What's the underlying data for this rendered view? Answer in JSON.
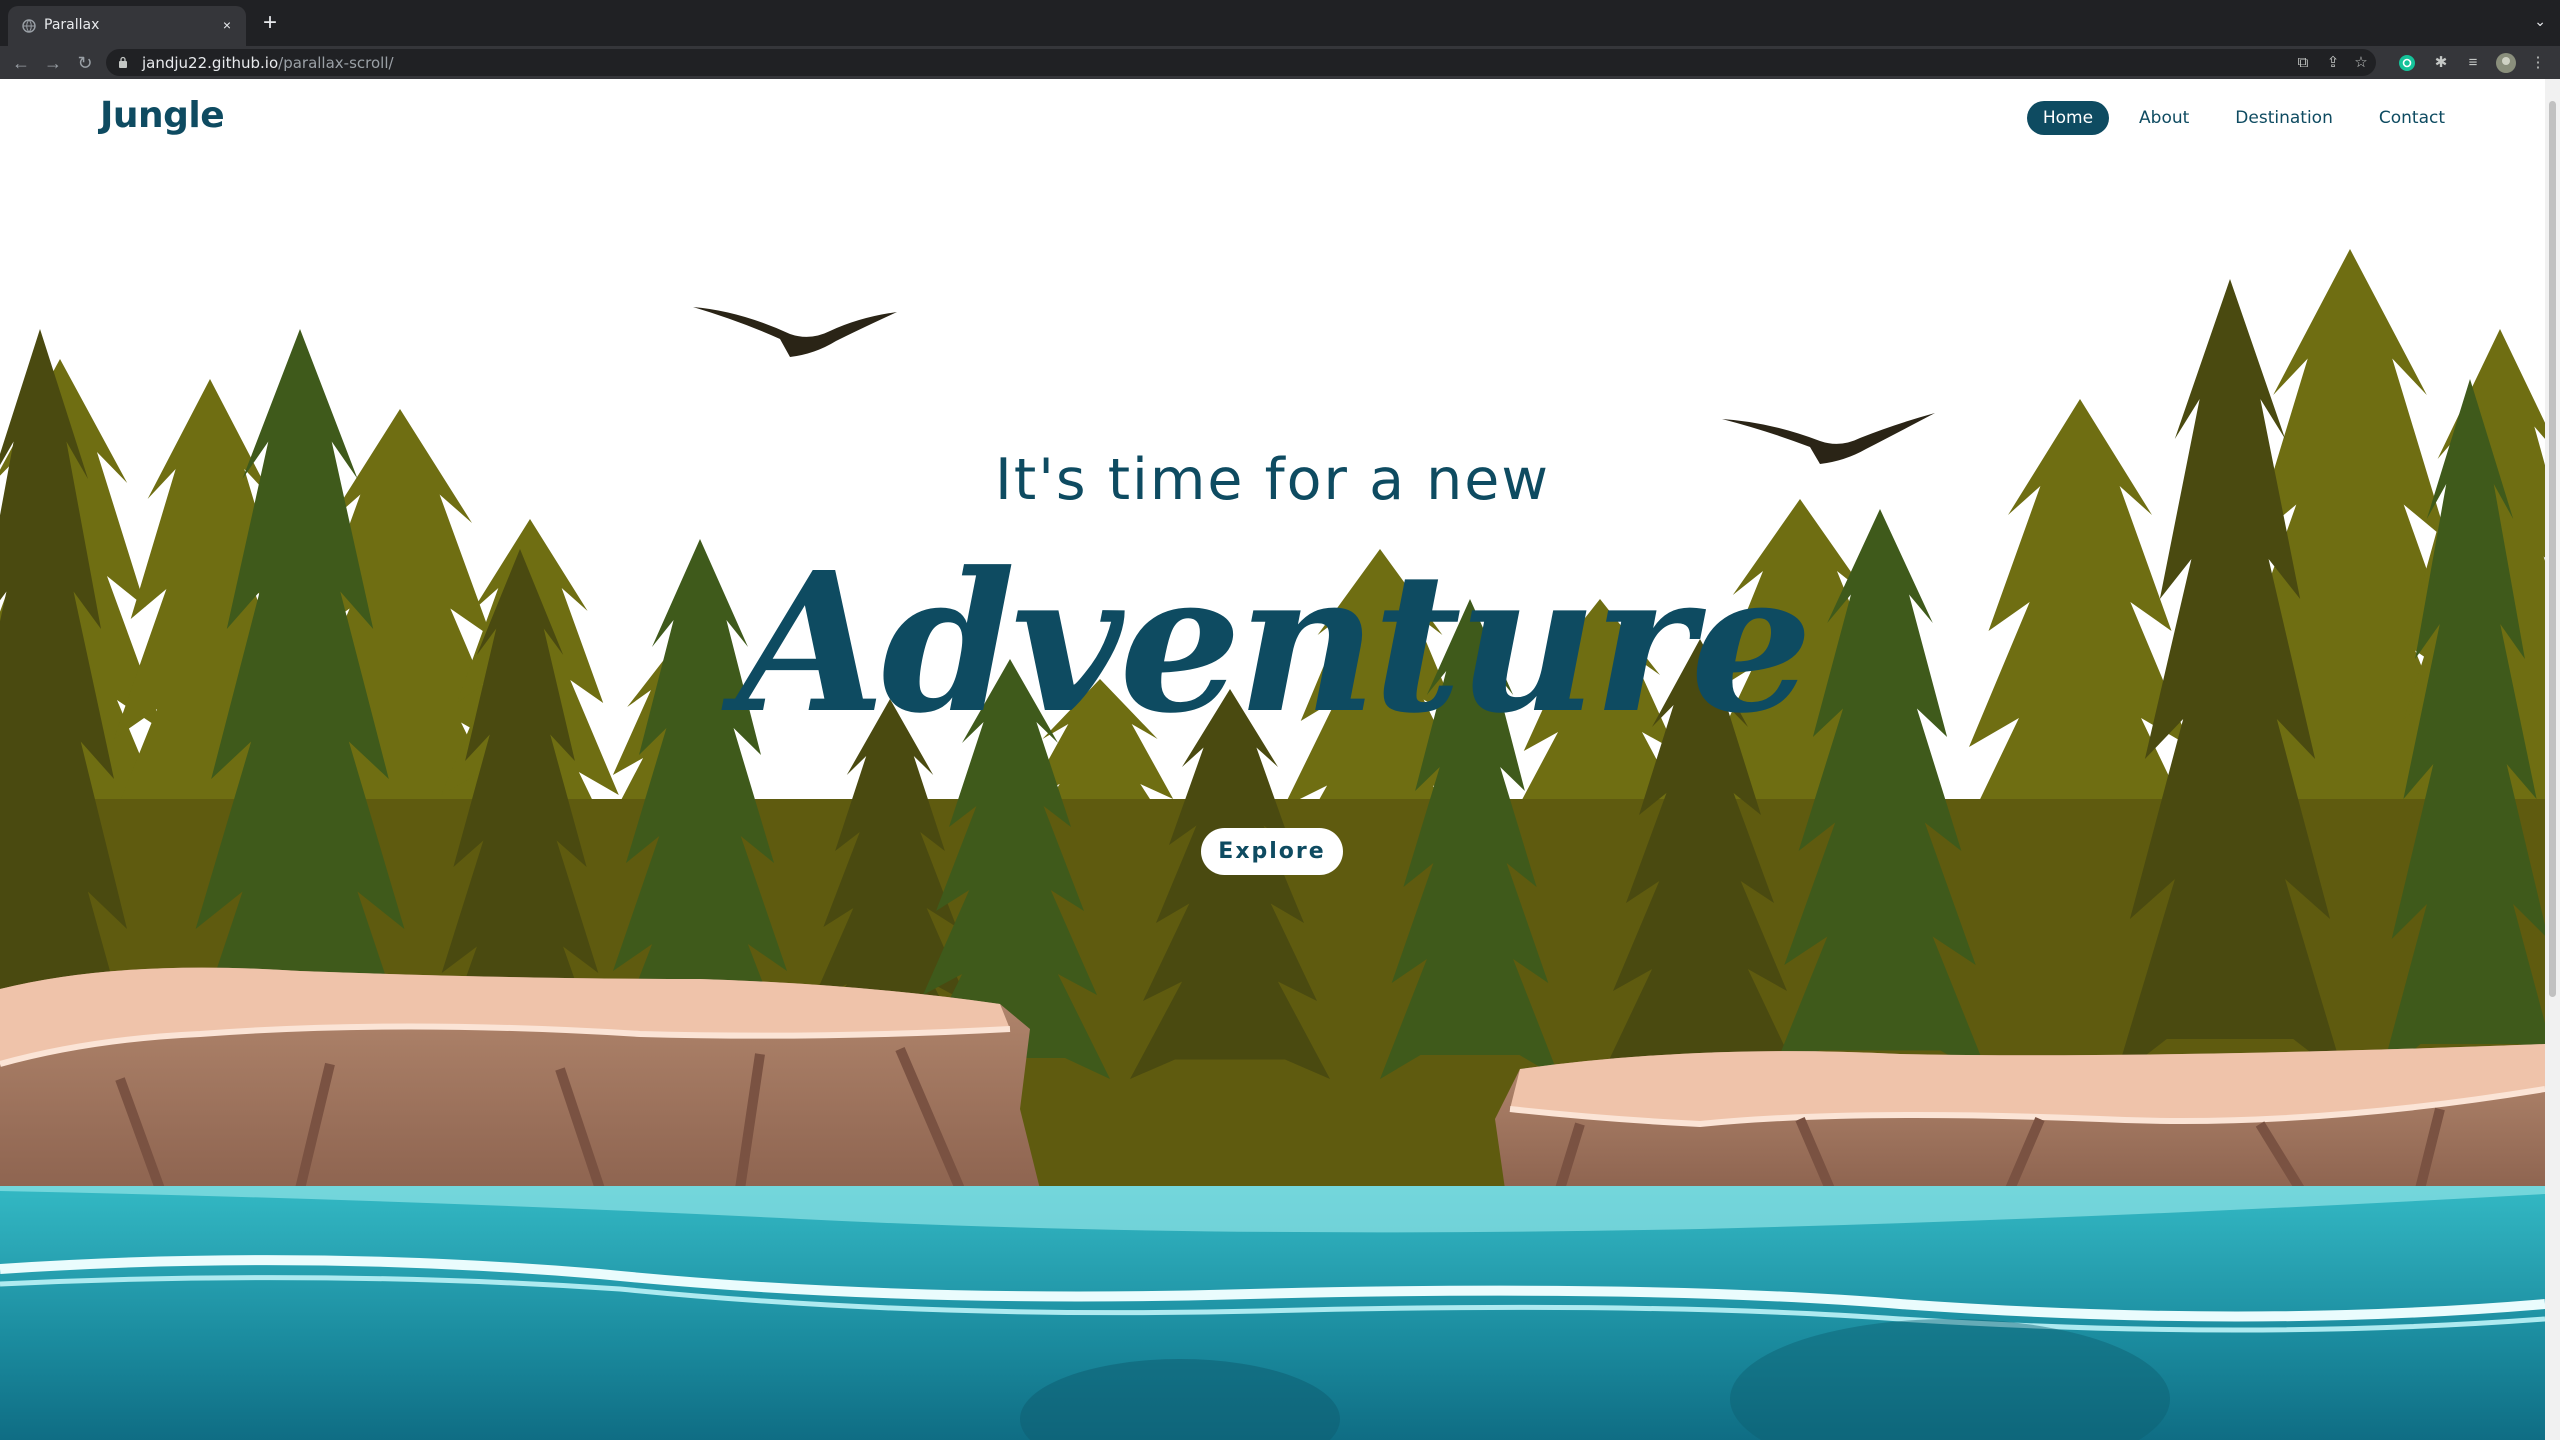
{
  "browser": {
    "tab": {
      "title": "Parallax",
      "close_icon": "×"
    },
    "new_tab_icon": "+",
    "url": {
      "host": "jandju22.github.io",
      "path": "/parallax-scroll/"
    }
  },
  "site": {
    "logo": "Jungle",
    "nav": [
      {
        "label": "Home",
        "active": true
      },
      {
        "label": "About",
        "active": false
      },
      {
        "label": "Destination",
        "active": false
      },
      {
        "label": "Contact",
        "active": false
      }
    ],
    "hero": {
      "subtitle": "It's time for a new",
      "title": "Adventure",
      "button": "Explore"
    }
  },
  "colors": {
    "brand": "#0e4b61",
    "forest_light": "#6f6e12",
    "forest_dark": "#3d3a0c",
    "pine_green": "#3f5a1b",
    "cliff": "#a67c63",
    "cliff_top": "#efc3aa",
    "water": "#1e8fa3"
  }
}
